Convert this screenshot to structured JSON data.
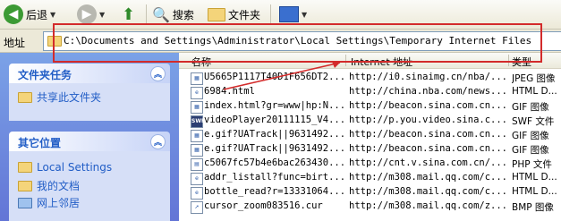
{
  "toolbar": {
    "back_label": "后退",
    "search_label": "搜索",
    "folders_label": "文件夹"
  },
  "address": {
    "label": "地址",
    "path": "C:\\Documents and Settings\\Administrator\\Local Settings\\Temporary Internet Files"
  },
  "left_panel": {
    "file_tasks": {
      "title": "文件夹任务",
      "items": [
        {
          "label": "共享此文件夹",
          "icon": "share-folder-icon"
        }
      ]
    },
    "other_places": {
      "title": "其它位置",
      "items": [
        {
          "label": "Local Settings",
          "icon": "folder-icon"
        },
        {
          "label": "我的文档",
          "icon": "my-documents-icon"
        },
        {
          "label": "网上邻居",
          "icon": "network-icon"
        }
      ]
    }
  },
  "list": {
    "columns": {
      "name": "名称",
      "address": "Internet 地址",
      "type": "类型"
    },
    "rows": [
      {
        "name": "U5665P1117T40D1F656DT2...",
        "url": "http://i0.sinaimg.cn/nba/...",
        "type": "JPEG 图像",
        "icon": "jpeg-file-icon"
      },
      {
        "name": "6984.html",
        "url": "http://china.nba.com/news...",
        "type": "HTML D...",
        "icon": "html-file-icon"
      },
      {
        "name": "index.html?gr=www|hp:N...",
        "url": "http://beacon.sina.com.cn...",
        "type": "GIF 图像",
        "icon": "gif-file-icon"
      },
      {
        "name": "videoPlayer20111115_V4...",
        "url": "http://p.you.video.sina.c...",
        "type": "SWF 文件",
        "icon": "swf-file-icon"
      },
      {
        "name": "e.gif?UATrack||9631492...",
        "url": "http://beacon.sina.com.cn...",
        "type": "GIF 图像",
        "icon": "gif-file-icon"
      },
      {
        "name": "e.gif?UATrack||9631492...",
        "url": "http://beacon.sina.com.cn...",
        "type": "GIF 图像",
        "icon": "gif-file-icon"
      },
      {
        "name": "c5067fc57b4e6bac263430...",
        "url": "http://cnt.v.sina.com.cn/...",
        "type": "PHP 文件",
        "icon": "php-file-icon"
      },
      {
        "name": "addr_listall?func=birt...",
        "url": "http://m308.mail.qq.com/c...",
        "type": "HTML D...",
        "icon": "html-file-icon"
      },
      {
        "name": "bottle_read?r=13331064...",
        "url": "http://m308.mail.qq.com/c...",
        "type": "HTML D...",
        "icon": "html-file-icon"
      },
      {
        "name": "cursor_zoom083516.cur",
        "url": "http://m308.mail.qq.com/z...",
        "type": "BMP 图像",
        "icon": "cur-file-icon"
      }
    ]
  },
  "colors": {
    "highlight": "#d32b2b",
    "panel_blue": "#6375d6",
    "link_blue": "#215dc6"
  }
}
